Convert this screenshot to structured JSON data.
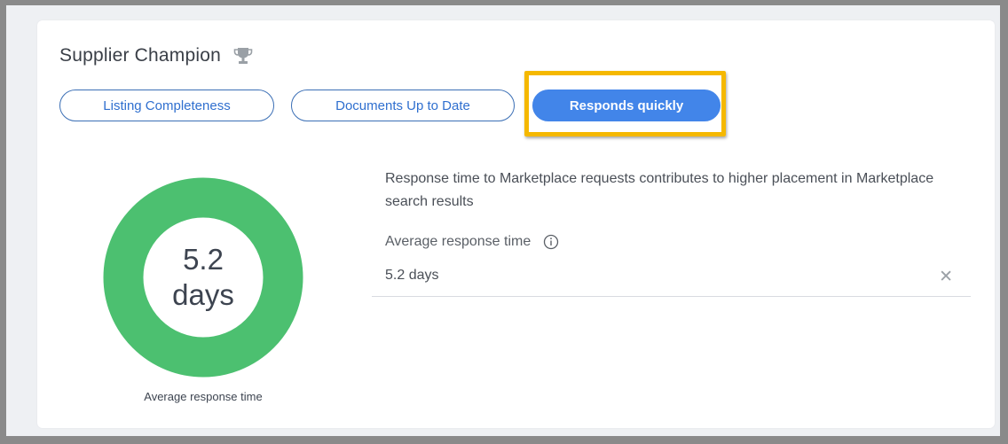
{
  "card": {
    "title": "Supplier Champion",
    "title_icon": "trophy-icon"
  },
  "tabs": [
    {
      "label": "Listing Completeness",
      "active": false
    },
    {
      "label": "Documents Up to Date",
      "active": false
    },
    {
      "label": "Responds quickly",
      "active": true
    }
  ],
  "donut": {
    "value": "5.2",
    "unit": "days",
    "caption": "Average response time",
    "ring_color": "#4cc070",
    "fill_fraction": 1.0
  },
  "description": "Response time to Marketplace requests contributes to higher placement in Marketplace search results",
  "field": {
    "label": "Average response time",
    "info_icon": "info-icon",
    "value": "5.2 days",
    "clear_icon": "close-icon"
  },
  "colors": {
    "accent": "#4285e9",
    "highlight": "#f5b800"
  }
}
